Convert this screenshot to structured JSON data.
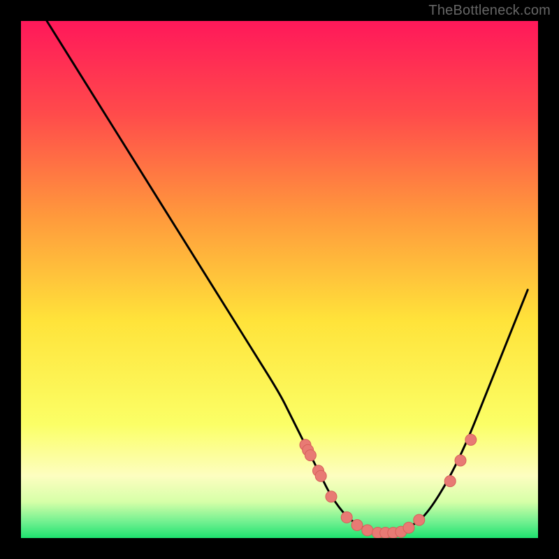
{
  "watermark": "TheBottleneck.com",
  "colors": {
    "bg": "#000000",
    "curve": "#000000",
    "marker_fill": "#e87a74",
    "marker_stroke": "#d65f59",
    "grad_top": "#ff185a",
    "grad_mid_upper": "#ff8a3c",
    "grad_mid": "#ffe33a",
    "grad_low": "#fdfec0",
    "grad_green_pale": "#d6ffa8",
    "grad_green": "#1ee26f"
  },
  "chart_data": {
    "type": "line",
    "title": "",
    "xlabel": "",
    "ylabel": "",
    "xlim": [
      0,
      100
    ],
    "ylim": [
      0,
      100
    ],
    "series": [
      {
        "name": "bottleneck-curve",
        "x": [
          5,
          10,
          15,
          20,
          25,
          30,
          35,
          40,
          45,
          50,
          52,
          55,
          58,
          60,
          63,
          66,
          69,
          72,
          75,
          78,
          82,
          86,
          90,
          94,
          98
        ],
        "y": [
          100,
          92,
          84,
          76,
          68,
          60,
          52,
          44,
          36,
          28,
          24,
          18,
          12,
          8,
          4,
          2,
          1,
          1,
          2,
          4,
          10,
          18,
          28,
          38,
          48
        ]
      }
    ],
    "markers": {
      "name": "highlight-points",
      "x": [
        55,
        55.5,
        56,
        57.5,
        58,
        60,
        63,
        65,
        67,
        69,
        70.5,
        72,
        73.5,
        75,
        77,
        83,
        85,
        87
      ],
      "y": [
        18,
        17,
        16,
        13,
        12,
        8,
        4,
        2.5,
        1.5,
        1,
        1,
        1,
        1.2,
        2,
        3.5,
        11,
        15,
        19
      ]
    },
    "annotations": []
  }
}
